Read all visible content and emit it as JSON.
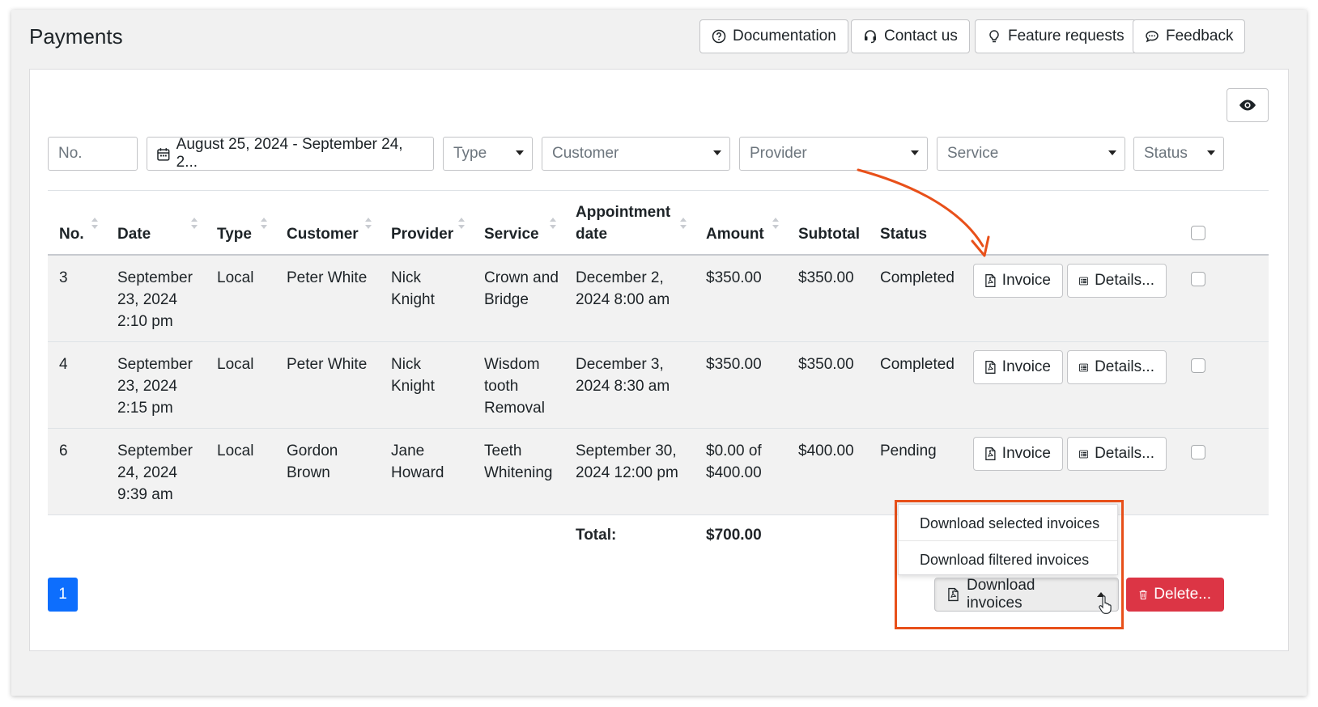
{
  "header": {
    "title": "Payments",
    "buttons": [
      {
        "label": "Documentation",
        "icon": "question-circle-icon"
      },
      {
        "label": "Contact us",
        "icon": "headset-icon"
      },
      {
        "label": "Feature requests",
        "icon": "lightbulb-icon"
      },
      {
        "label": "Feedback",
        "icon": "chat-bubble-icon"
      }
    ]
  },
  "filters": {
    "number_placeholder": "No.",
    "date_range": "August 25, 2024 - September 24, 2...",
    "type": "Type",
    "customer": "Customer",
    "provider": "Provider",
    "service": "Service",
    "status": "Status"
  },
  "table": {
    "columns": [
      "No.",
      "Date",
      "Type",
      "Customer",
      "Provider",
      "Service",
      "Appointment\ndate",
      "Amount",
      "Subtotal",
      "Status"
    ],
    "rows": [
      {
        "no": "3",
        "date": "September\n23, 2024\n2:10 pm",
        "type": "Local",
        "customer": "Peter White",
        "provider": "Nick\nKnight",
        "service": "Crown and\nBridge",
        "appointment": "December 2,\n2024 8:00 am",
        "amount": "$350.00",
        "subtotal": "$350.00",
        "status": "Completed"
      },
      {
        "no": "4",
        "date": "September\n23, 2024\n2:15 pm",
        "type": "Local",
        "customer": "Peter White",
        "provider": "Nick\nKnight",
        "service": "Wisdom\ntooth\nRemoval",
        "appointment": "December 3,\n2024 8:30 am",
        "amount": "$350.00",
        "subtotal": "$350.00",
        "status": "Completed"
      },
      {
        "no": "6",
        "date": "September\n24, 2024\n9:39 am",
        "type": "Local",
        "customer": "Gordon\nBrown",
        "provider": "Jane\nHoward",
        "service": "Teeth\nWhitening",
        "appointment": "September 30,\n2024 12:00 pm",
        "amount": "$0.00 of\n$400.00",
        "subtotal": "$400.00",
        "status": "Pending"
      }
    ],
    "row_actions": {
      "invoice": "Invoice",
      "details": "Details..."
    },
    "total_label": "Total:",
    "total_value": "$700.00"
  },
  "pagination": {
    "current_page": "1"
  },
  "download_menu": {
    "items": [
      "Download selected invoices",
      "Download filtered invoices"
    ],
    "button_label": "Download invoices"
  },
  "delete_label": "Delete...",
  "colors": {
    "accent": "#0d6efd",
    "danger": "#dc3545",
    "highlight": "#e8501a"
  }
}
